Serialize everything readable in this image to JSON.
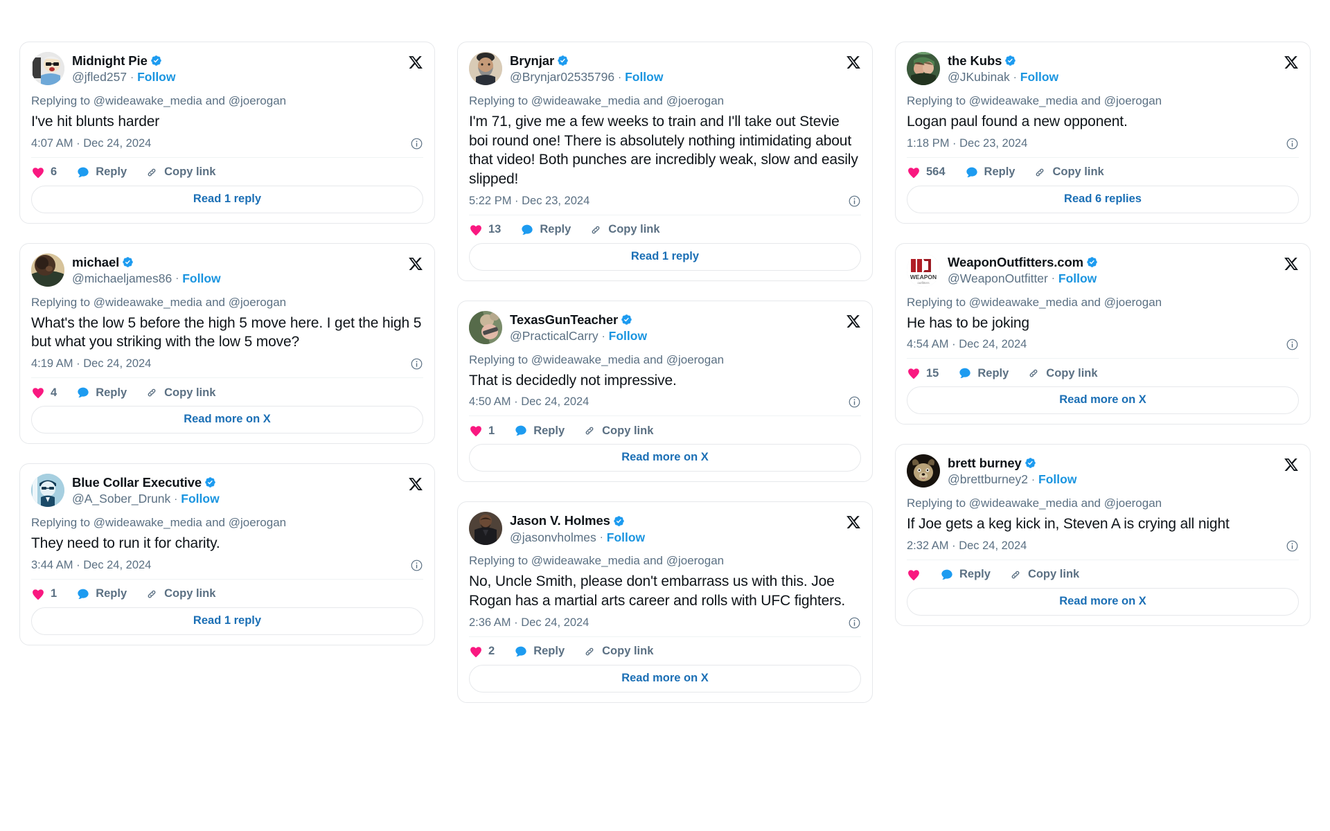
{
  "colors": {
    "accent_blue": "#1b95e0",
    "link_blue": "#1b6fb5",
    "like_pink": "#f91880",
    "reply_blue": "#1d9bf0",
    "verified_blue": "#1d9bf0",
    "text_primary": "#0f1419",
    "text_secondary": "#5b7083",
    "card_border": "#e6e8eb",
    "page_background": "#ffffff"
  },
  "labels": {
    "follow": "Follow",
    "reply": "Reply",
    "copy_link": "Copy link",
    "separator": "·",
    "x_logo_icon": "x-logo-icon",
    "info_icon": "info-icon",
    "like_icon": "heart-icon",
    "reply_icon": "speech-bubble-icon",
    "copy_link_icon": "link-chain-icon",
    "verified_icon": "verified-badge-icon"
  },
  "columns": [
    {
      "cards": [
        {
          "display_name": "Midnight Pie",
          "handle": "@jfled257",
          "verified": true,
          "replying_to": "Replying to @wideawake_media and @joerogan",
          "text": "I've hit blunts harder",
          "timestamp": "4:07 AM · Dec 24, 2024",
          "like_count": "6",
          "read_button": "Read 1 reply",
          "avatar_style": "midnight-pie"
        },
        {
          "display_name": "michael",
          "handle": "@michaeljames86",
          "verified": true,
          "replying_to": "Replying to @wideawake_media and @joerogan",
          "text": "What's the low 5 before the high 5 move here. I get the high 5 but what you striking with the low 5 move?",
          "timestamp": "4:19 AM · Dec 24, 2024",
          "like_count": "4",
          "read_button": "Read more on X",
          "avatar_style": "michael"
        },
        {
          "display_name": "Blue Collar Executive",
          "handle": "@A_Sober_Drunk",
          "verified": true,
          "replying_to": "Replying to @wideawake_media and @joerogan",
          "text": "They need to run it for charity.",
          "timestamp": "3:44 AM · Dec 24, 2024",
          "like_count": "1",
          "read_button": "Read 1 reply",
          "avatar_style": "blue-collar"
        }
      ]
    },
    {
      "cards": [
        {
          "display_name": "Brynjar",
          "handle": "@Brynjar02535796",
          "verified": true,
          "replying_to": "Replying to @wideawake_media and @joerogan",
          "text": "I'm 71, give me a few weeks to train and I'll take out Stevie boi round one! There is absolutely nothing intimidating about that video! Both punches are incredibly weak, slow and easily slipped!",
          "timestamp": "5:22 PM · Dec 23, 2024",
          "like_count": "13",
          "read_button": "Read 1 reply",
          "avatar_style": "brynjar"
        },
        {
          "display_name": "TexasGunTeacher",
          "handle": "@PracticalCarry",
          "verified": true,
          "replying_to": "Replying to @wideawake_media and @joerogan",
          "text": "That is decidedly not impressive.",
          "timestamp": "4:50 AM · Dec 24, 2024",
          "like_count": "1",
          "read_button": "Read more on X",
          "avatar_style": "texasgun"
        },
        {
          "display_name": "Jason V. Holmes",
          "handle": "@jasonvholmes",
          "verified": true,
          "replying_to": "Replying to @wideawake_media and @joerogan",
          "text": "No, Uncle Smith, please don't embarrass us with this. Joe Rogan has a martial arts career and rolls with UFC fighters.",
          "timestamp": "2:36 AM · Dec 24, 2024",
          "like_count": "2",
          "read_button": "Read more on X",
          "avatar_style": "jason"
        }
      ]
    },
    {
      "cards": [
        {
          "display_name": "the Kubs",
          "handle": "@JKubinak",
          "verified": true,
          "replying_to": "Replying to @wideawake_media and @joerogan",
          "text": "Logan paul found a new opponent.",
          "timestamp": "1:18 PM · Dec 23, 2024",
          "like_count": "564",
          "read_button": "Read 6 replies",
          "avatar_style": "kubs"
        },
        {
          "display_name": "WeaponOutfitters.com",
          "handle": "@WeaponOutfitter",
          "verified": true,
          "replying_to": "Replying to @wideawake_media and @joerogan",
          "text": "He has to be joking",
          "timestamp": "4:54 AM · Dec 24, 2024",
          "like_count": "15",
          "read_button": "Read more on X",
          "avatar_style": "weapon"
        },
        {
          "display_name": "brett burney",
          "handle": "@brettburney2",
          "verified": true,
          "replying_to": "Replying to @wideawake_media and @joerogan",
          "text": "If Joe gets a keg kick in, Steven A is crying all night",
          "timestamp": "2:32 AM · Dec 24, 2024",
          "like_count": "",
          "read_button": "Read more on X",
          "avatar_style": "brett"
        }
      ]
    }
  ]
}
